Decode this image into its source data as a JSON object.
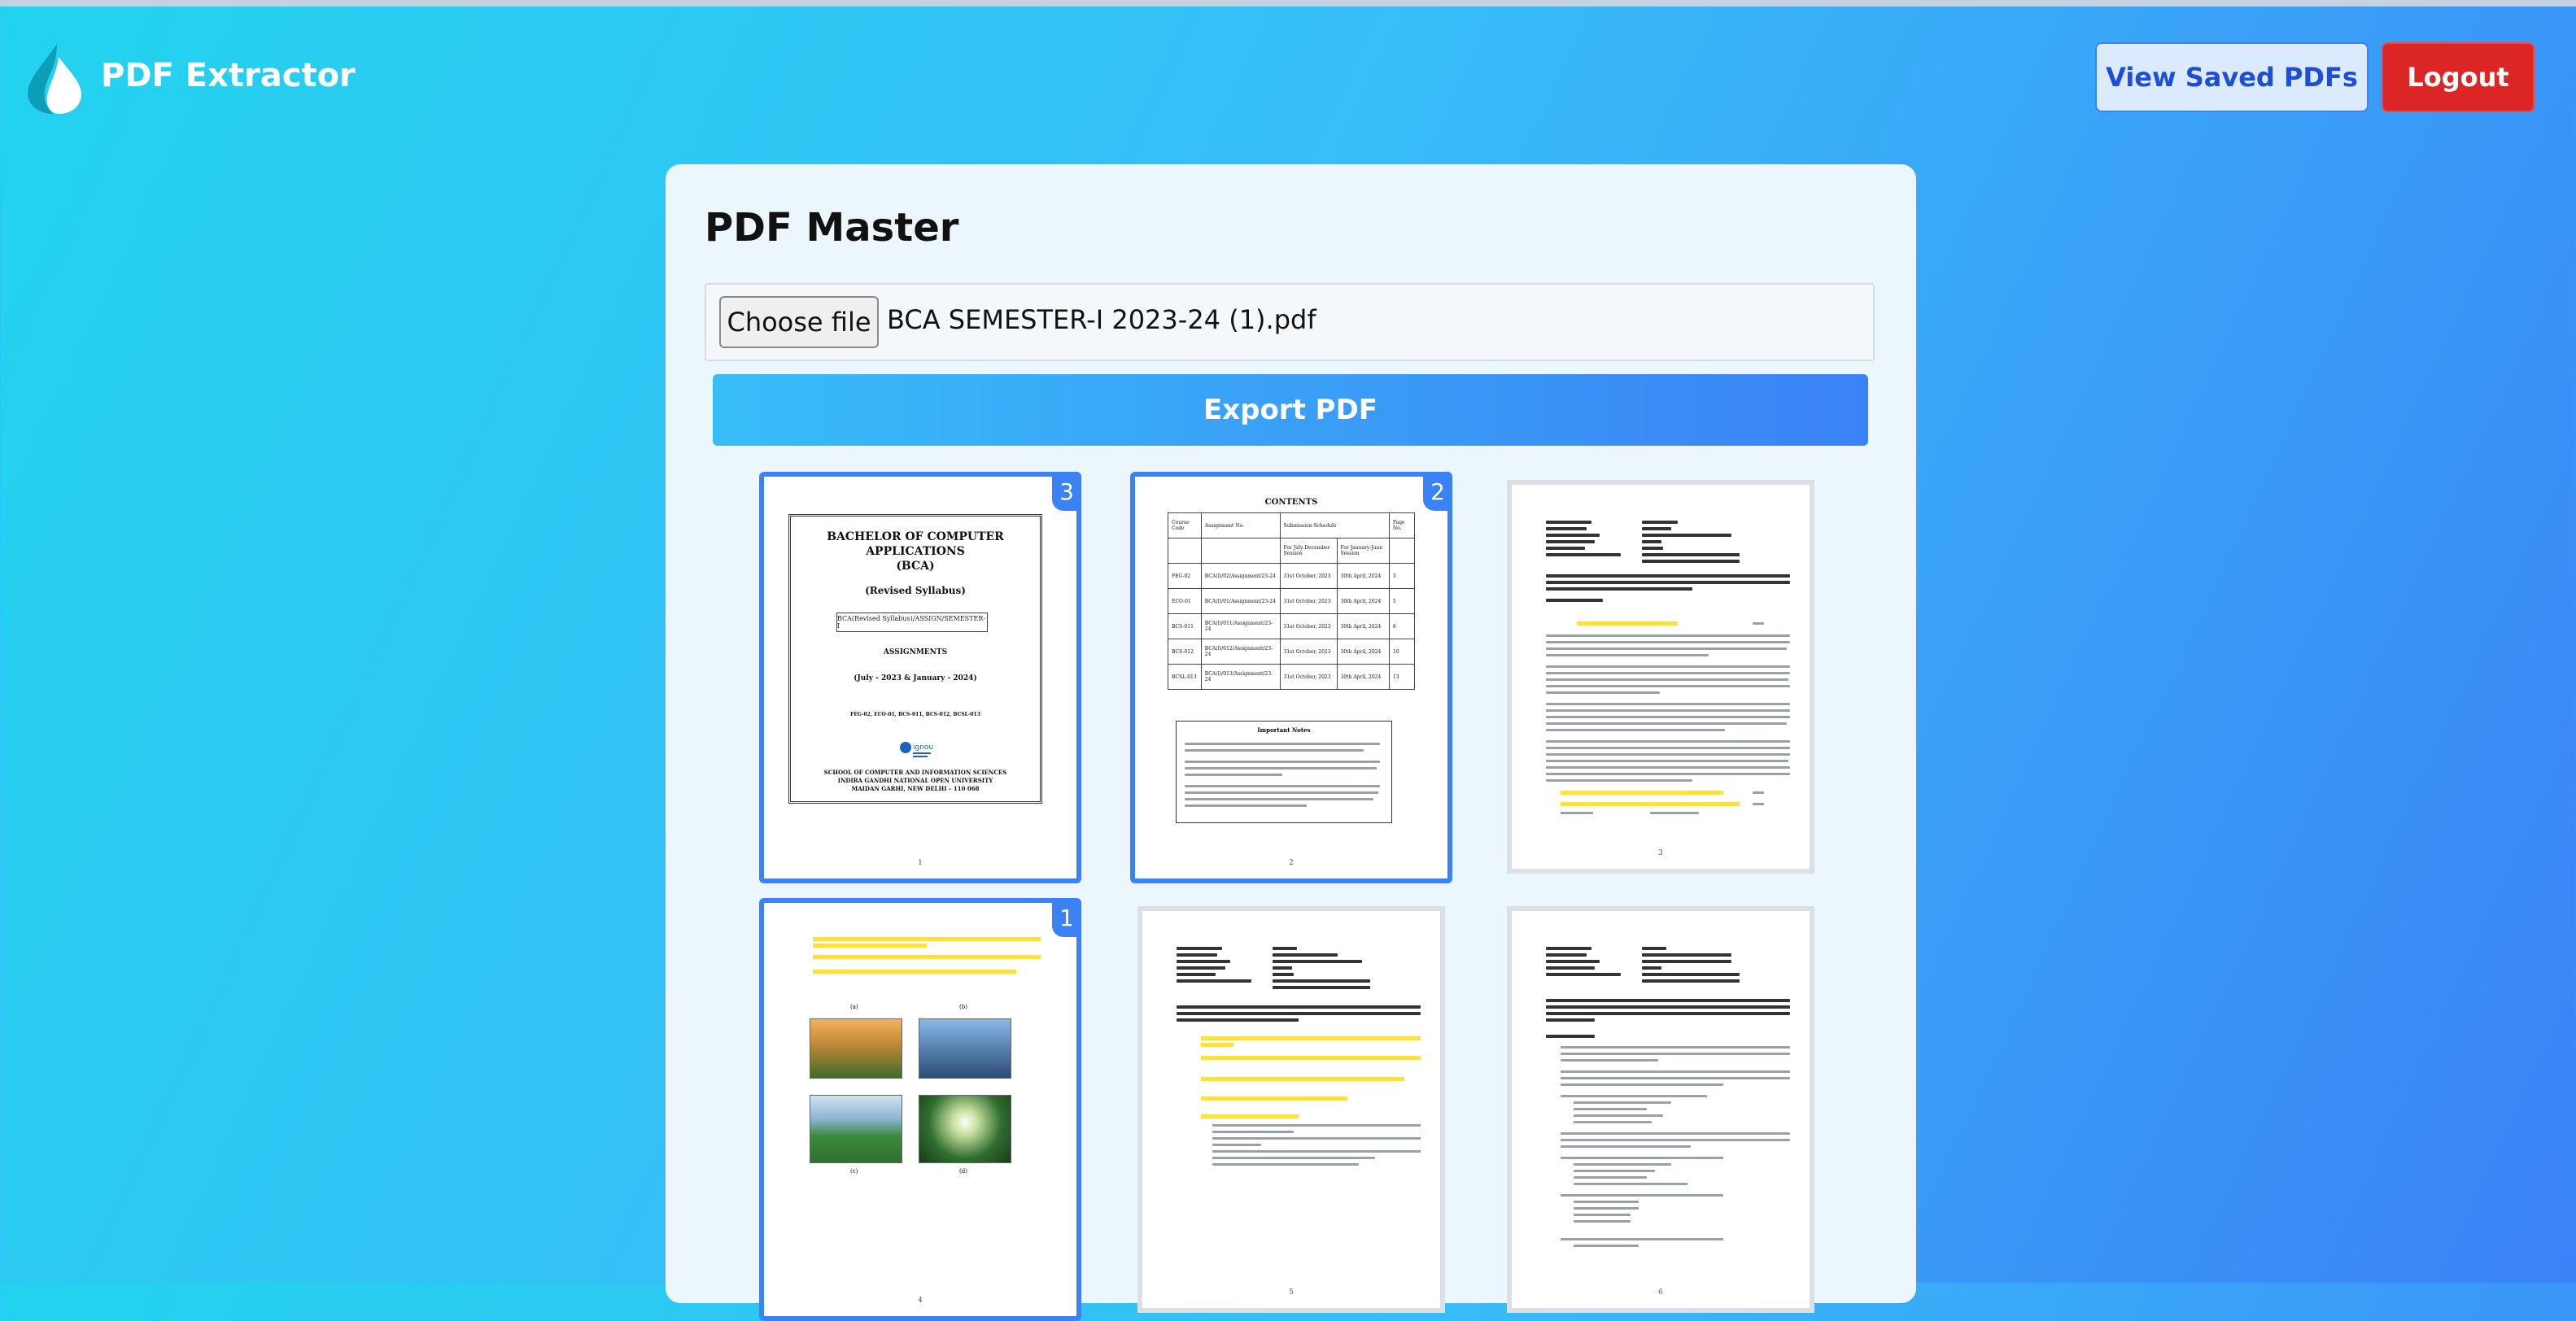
{
  "header": {
    "app_title": "PDF Extractor",
    "view_saved_label": "View Saved PDFs",
    "logout_label": "Logout"
  },
  "main": {
    "page_title": "PDF Master",
    "file_input": {
      "button_label": "Choose file",
      "selected_file": "BCA SEMESTER-I 2023-24 (1).pdf"
    },
    "export_label": "Export PDF"
  },
  "thumbnails": [
    {
      "page": 1,
      "selected": true,
      "order": "3"
    },
    {
      "page": 2,
      "selected": true,
      "order": "2"
    },
    {
      "page": 3,
      "selected": false,
      "order": ""
    },
    {
      "page": 4,
      "selected": true,
      "order": "1"
    },
    {
      "page": 5,
      "selected": false,
      "order": ""
    },
    {
      "page": 6,
      "selected": false,
      "order": ""
    }
  ],
  "pages": {
    "p1": {
      "title_lines": [
        "BACHELOR OF COMPUTER",
        "APPLICATIONS",
        "(BCA)"
      ],
      "revised": "(Revised Syllabus)",
      "box_text": "BCA(Revised Syllabus)/ASSIGN/SEMESTER-I",
      "assignments": "ASSIGNMENTS",
      "session": "(July - 2023 & January - 2024)",
      "course_codes": "FEG-02, ECO-01, BCS-011, BCS-012, BCSL-013",
      "logo_text": "ignou",
      "school_lines": [
        "SCHOOL OF COMPUTER AND INFORMATION SCIENCES",
        "INDIRA GANDHI NATIONAL OPEN UNIVERSITY",
        "MAIDAN GARHI, NEW DELHI – 110 068"
      ],
      "page_number": "1"
    },
    "p2": {
      "heading": "CONTENTS",
      "columns": [
        "Course Code",
        "Assignment No.",
        "Submission-Schedule",
        "Page No."
      ],
      "subcolumns": [
        "For July-December Session",
        "For January-June Session"
      ],
      "rows": [
        [
          "FEG-02",
          "BCA(I)/02/Assignment/23-24",
          "31st October, 2023",
          "30th April, 2024",
          "3"
        ],
        [
          "ECO-01",
          "BCA(I)/01/Assignment/23-24",
          "31st October, 2023",
          "30th April, 2024",
          "5"
        ],
        [
          "BCS-011",
          "BCA(I)/011/Assignment/23-24",
          "31st October, 2023",
          "30th April, 2024",
          "6"
        ],
        [
          "BCS-012",
          "BCA(I)/012/Assignment/23-24",
          "31st October, 2023",
          "30th April, 2024",
          "10"
        ],
        [
          "BCSL-013",
          "BCA(I)/013/Assignment/23-24",
          "31st October, 2023",
          "30th April, 2024",
          "13"
        ]
      ],
      "note_heading": "Important Notes",
      "page_number": "2"
    },
    "p3": {
      "page_number": "3"
    },
    "p4": {
      "captions": [
        "(a)",
        "(b)",
        "(c)",
        "(d)"
      ],
      "page_number": "4"
    },
    "p5": {
      "page_number": "5"
    },
    "p6": {
      "page_number": "6"
    }
  }
}
